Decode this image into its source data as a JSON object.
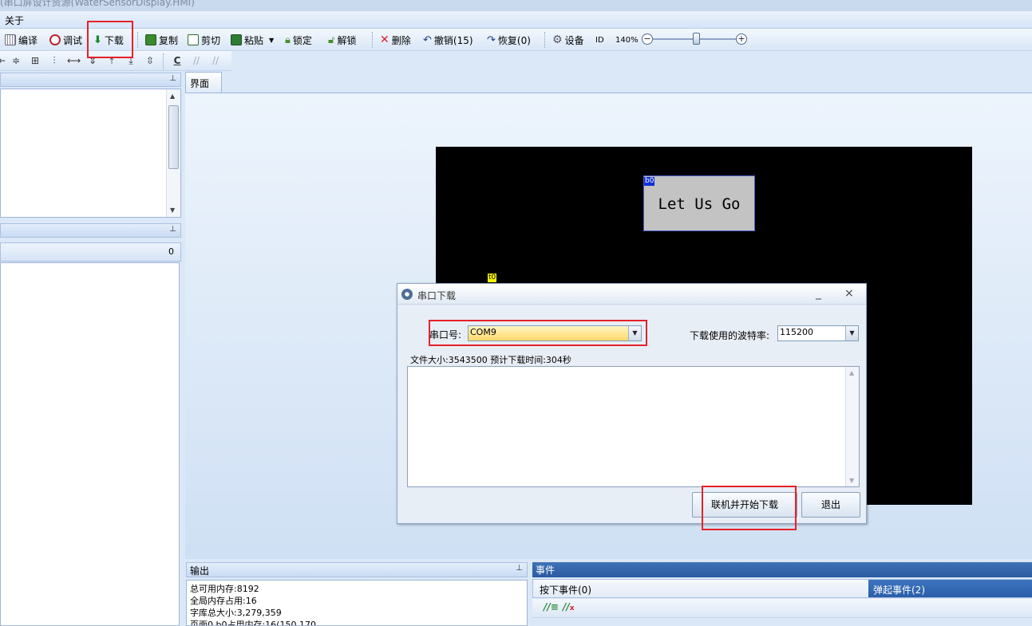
{
  "window": {
    "title_remnant": "(串口屏设计资源(WaterSensorDisplay.HMI)"
  },
  "menu": {
    "about": "关于"
  },
  "toolbar": {
    "compile": "编译",
    "debug": "调试",
    "download": "下载",
    "copy": "复制",
    "cut": "剪切",
    "paste": "粘贴",
    "lock": "锁定",
    "unlock": "解锁",
    "delete": "删除",
    "undo": "撤销(15)",
    "redo": "恢复(0)",
    "device": "设备",
    "id": "ID",
    "zoom": "140%",
    "zoom_out": "−",
    "zoom_in": "+"
  },
  "toolbar2": {
    "code_label": "C"
  },
  "left": {
    "attr_count": "0"
  },
  "main": {
    "tab_label": "界面"
  },
  "canvas": {
    "button_text": "Let Us Go",
    "button_id": "b0",
    "text_id": "t0"
  },
  "dialog": {
    "title": "串口下载",
    "port_label": "串口号:",
    "port_value": "COM9",
    "baud_label": "下载使用的波特率:",
    "baud_value": "115200",
    "file_info": "文件大小:3543500  预计下载时间:304秒",
    "start_button": "联机并开始下载",
    "exit_button": "退出",
    "minimize": "_",
    "close": "×"
  },
  "output": {
    "header": "输出",
    "lines": [
      "总可用内存:8192",
      "全局内存占用:16",
      "字库总大小:3,279,359",
      "页面0 b0占用内存:16(150,170"
    ]
  },
  "events": {
    "header": "事件",
    "tab_press": "按下事件(0)",
    "tab_release": "弹起事件(2)"
  },
  "colors": {
    "accent_red": "#e6212a",
    "canvas_black": "#000000",
    "combo_highlight": "#fde38a",
    "event_header": "#2a5aa0"
  }
}
